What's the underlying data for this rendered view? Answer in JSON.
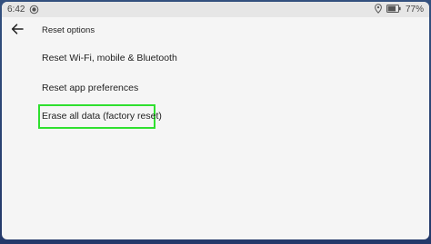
{
  "status_bar": {
    "time": "6:42",
    "notification_icon": "record-circle-icon",
    "location_icon": "location-pin-icon",
    "battery_icon": "battery-icon",
    "battery_percent": "77%",
    "battery_level": 0.77
  },
  "toolbar": {
    "back_icon": "arrow-left-icon",
    "title": "Reset options"
  },
  "options": [
    {
      "label": "Reset Wi-Fi, mobile & Bluetooth"
    },
    {
      "label": "Reset app preferences"
    },
    {
      "label": "Erase all data (factory reset)",
      "highlighted": true
    }
  ],
  "colors": {
    "highlight_border": "#2fe02f",
    "background": "#f5f5f5",
    "status_bar": "#e6e6e6",
    "text": "#222222"
  }
}
